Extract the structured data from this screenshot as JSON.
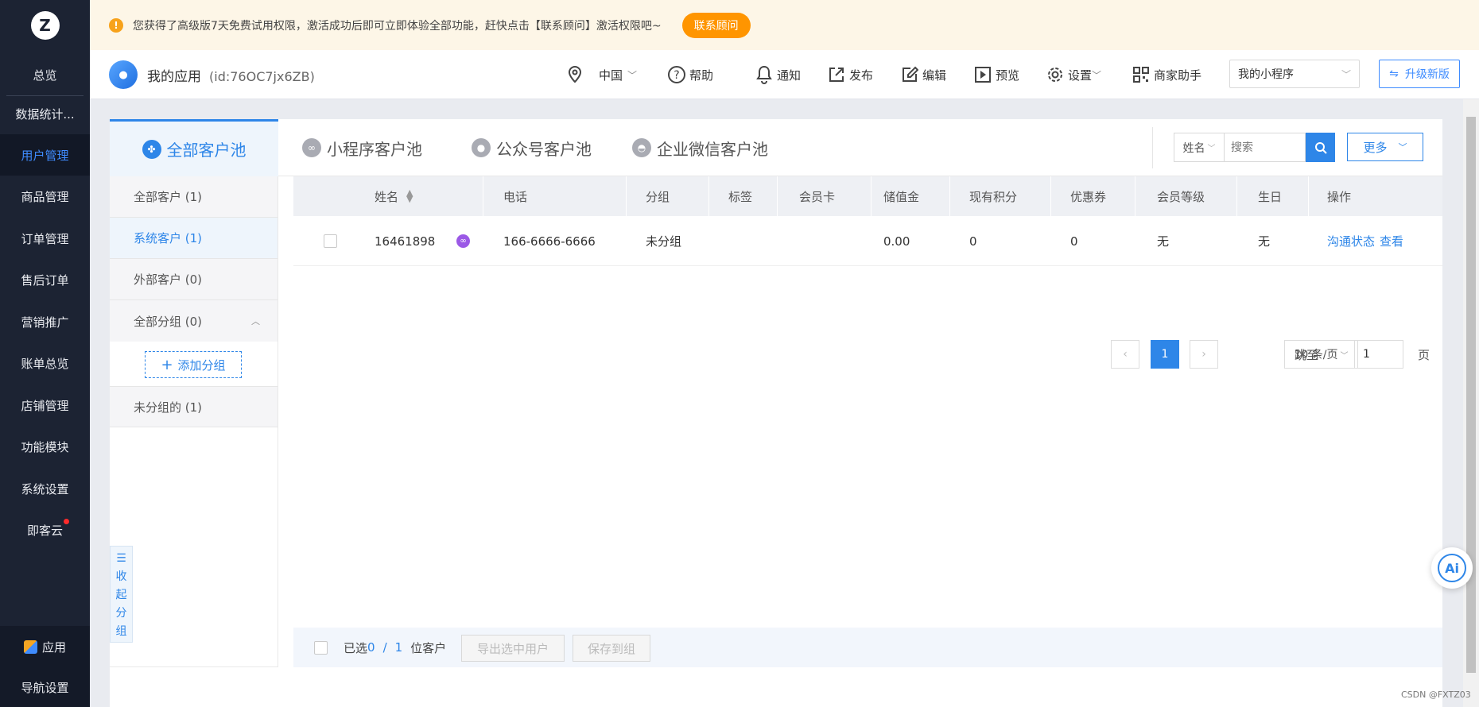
{
  "sidebar": {
    "logo_letter": "Z",
    "items": [
      {
        "label": "总览"
      },
      {
        "label": "数据统计..."
      },
      {
        "label": "用户管理"
      },
      {
        "label": "商品管理"
      },
      {
        "label": "订单管理"
      },
      {
        "label": "售后订单"
      },
      {
        "label": "营销推广"
      },
      {
        "label": "账单总览"
      },
      {
        "label": "店铺管理"
      },
      {
        "label": "功能模块"
      },
      {
        "label": "系统设置"
      },
      {
        "label": "即客云"
      }
    ],
    "active_index": 2,
    "bottom": {
      "app": "应用",
      "nav_settings": "导航设置"
    }
  },
  "notice": {
    "text": "您获得了高级版7天免费试用权限，激活成功后即可立即体验全部功能，赶快点击【联系顾问】激活权限吧~",
    "button": "联系顾问"
  },
  "header": {
    "app_name": "我的应用",
    "app_id": "(id:76OC7jx6ZB)",
    "region": "中国",
    "help": "帮助",
    "notify": "通知",
    "publish": "发布",
    "edit": "编辑",
    "preview": "预览",
    "settings": "设置",
    "merchant": "商家助手",
    "app_select": "我的小程序",
    "upgrade": "升级新版"
  },
  "tabs": [
    {
      "label": "全部客户池"
    },
    {
      "label": "小程序客户池"
    },
    {
      "label": "公众号客户池"
    },
    {
      "label": "企业微信客户池"
    }
  ],
  "search": {
    "field": "姓名",
    "placeholder": "搜索",
    "more": "更多"
  },
  "groups": {
    "all_customers": "全部客户 (1)",
    "system_customers": "系统客户 (1)",
    "external_customers": "外部客户 (0)",
    "all_groups": "全部分组 (0)",
    "add_group": "添加分组",
    "ungrouped": "未分组的 (1)",
    "collapse": [
      "收",
      "起",
      "分",
      "组"
    ]
  },
  "table": {
    "headers": [
      "姓名",
      "电话",
      "分组",
      "标签",
      "会员卡",
      "储值金",
      "现有积分",
      "优惠券",
      "会员等级",
      "生日",
      "操作"
    ],
    "rows": [
      {
        "name": "16461898",
        "phone": "166-6666-6666",
        "group": "未分组",
        "tag": "",
        "member_card": "",
        "balance": "0.00",
        "points": "0",
        "coupons": "0",
        "level": "无",
        "birthday": "无",
        "actions": [
          "沟通状态",
          "查看"
        ]
      }
    ]
  },
  "pagination": {
    "current": "1",
    "page_size": "10 条/页",
    "jump_label": "跳至",
    "jump_value": "1",
    "page_unit": "页"
  },
  "footer": {
    "selected_prefix": "已选",
    "selected": "0",
    "slash": "/",
    "total": "1",
    "suffix": "位客户",
    "export": "导出选中用户",
    "save_group": "保存到组"
  },
  "ai": "Ai",
  "watermark": "CSDN @FXTZ03"
}
